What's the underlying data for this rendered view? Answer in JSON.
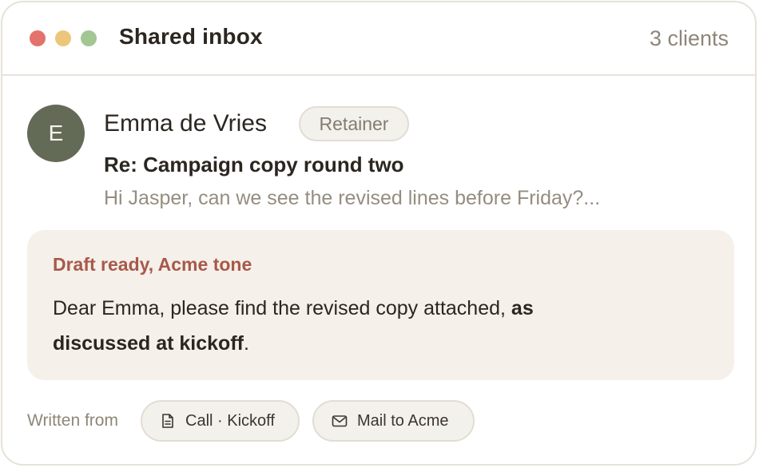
{
  "window": {
    "title": "Shared inbox",
    "client_count": "3 clients"
  },
  "message": {
    "avatar_initial": "E",
    "sender": "Emma de Vries",
    "badge": "Retainer",
    "subject": "Re: Campaign copy round two",
    "preview": "Hi Jasper, can we see the revised lines before Friday?..."
  },
  "draft": {
    "label": "Draft ready, Acme tone",
    "body_plain": "Dear Emma, please find the revised copy attached, ",
    "body_bold": "as discussed at kickoff",
    "body_end": "."
  },
  "footer": {
    "written_from_label": "Written from",
    "sources": [
      {
        "label": "Call · Kickoff",
        "icon": "document-icon"
      },
      {
        "label": "Mail to Acme",
        "icon": "envelope-icon"
      }
    ]
  },
  "colors": {
    "accent_draft_label": "#a8584a",
    "avatar_bg": "#636b56",
    "draft_bg": "#f5f0e9",
    "traffic_red": "#e2726b",
    "traffic_yellow": "#ecc67a",
    "traffic_green": "#a2c793"
  }
}
